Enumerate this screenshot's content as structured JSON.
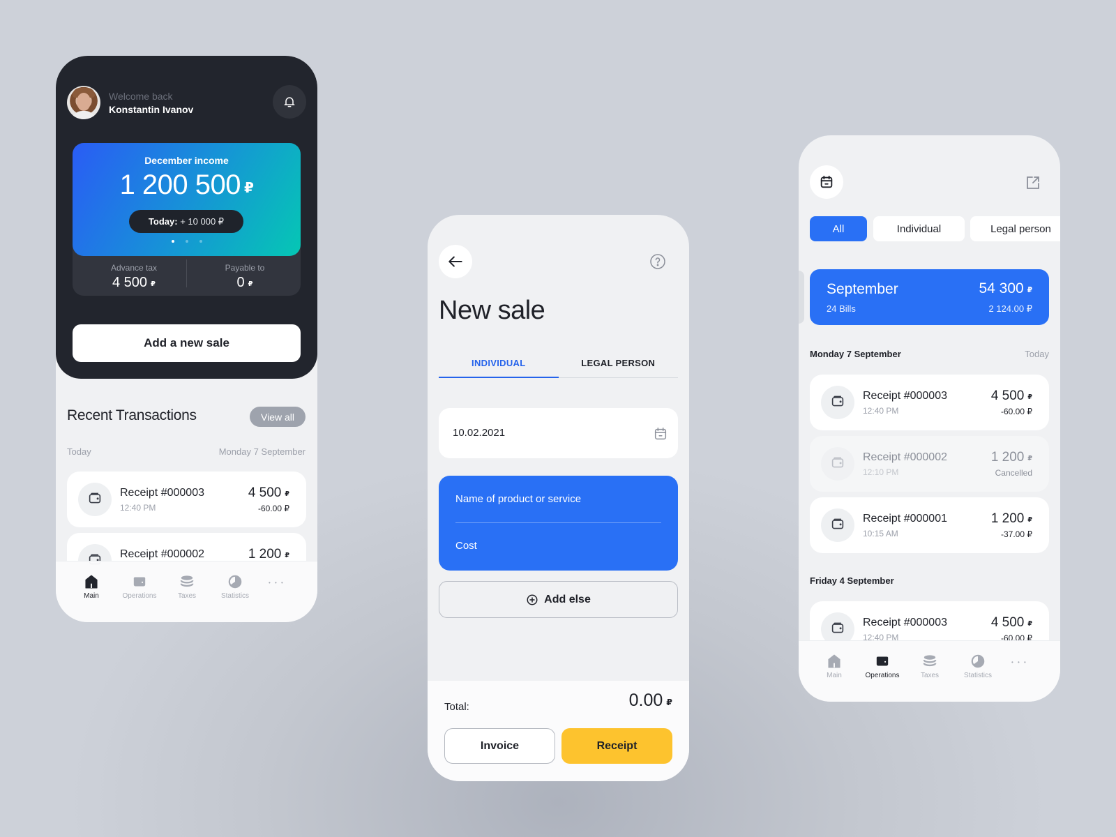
{
  "colors": {
    "accent_blue": "#2970f5",
    "dark_bg": "#22252d",
    "yellow": "#fdc32e",
    "page_bg": "#cdd1d9"
  },
  "home": {
    "welcome_label": "Welcome back",
    "user_name": "Konstantin Ivanov",
    "bell_icon": "bell-icon",
    "income_card": {
      "label": "December income",
      "amount": "1 200 500",
      "currency": "₽",
      "today_label": "Today:",
      "today_value": "+ 10 000 ₽",
      "pages": 3,
      "active_page": 1
    },
    "advance_tax": {
      "label": "Advance tax",
      "value": "4 500",
      "currency": "₽"
    },
    "payable_to": {
      "label": "Payable to",
      "value": "0",
      "currency": "₽"
    },
    "add_sale_label": "Add a new sale",
    "recent_title": "Recent Transactions",
    "view_all_label": "View all",
    "day_left": "Today",
    "day_right": "Monday 7 September",
    "transactions": [
      {
        "name": "Receipt #000003",
        "time": "12:40 PM",
        "amount": "4 500",
        "currency": "₽",
        "sub": "-60.00 ₽"
      },
      {
        "name": "Receipt #000002",
        "time": "",
        "amount": "1 200",
        "currency": "₽",
        "sub": ""
      }
    ],
    "tabbar": [
      {
        "label": "Main",
        "icon": "home-icon",
        "active": true
      },
      {
        "label": "Operations",
        "icon": "wallet-icon",
        "active": false
      },
      {
        "label": "Taxes",
        "icon": "coins-icon",
        "active": false
      },
      {
        "label": "Statistics",
        "icon": "pie-chart-icon",
        "active": false
      },
      {
        "label": "",
        "icon": "more-icon",
        "active": false
      }
    ]
  },
  "new_sale": {
    "title": "New sale",
    "tabs": [
      {
        "label": "INDIVIDUAL",
        "active": true
      },
      {
        "label": "LEGAL PERSON",
        "active": false
      }
    ],
    "date_value": "10.02.2021",
    "product_placeholder": "Name of product or service",
    "cost_placeholder": "Cost",
    "add_else_label": "Add else",
    "total_label": "Total:",
    "total_value": "0.00",
    "total_currency": "₽",
    "invoice_label": "Invoice",
    "receipt_label": "Receipt"
  },
  "operations": {
    "filters": [
      {
        "label": "All",
        "active": true
      },
      {
        "label": "Individual",
        "active": false
      },
      {
        "label": "Legal person",
        "active": false
      }
    ],
    "month_card": {
      "month": "September",
      "bills": "24 Bills",
      "amount": "54 300",
      "currency": "₽",
      "sub": "2 124.00 ₽"
    },
    "groups": [
      {
        "title": "Monday 7 September",
        "right": "Today",
        "items": [
          {
            "name": "Receipt #000003",
            "time": "12:40 PM",
            "amount": "4 500",
            "currency": "₽",
            "sub": "-60.00 ₽",
            "cancelled": false
          },
          {
            "name": "Receipt #000002",
            "time": "12:10 PM",
            "amount": "1 200",
            "currency": "₽",
            "sub": "Cancelled",
            "cancelled": true
          },
          {
            "name": "Receipt #000001",
            "time": "10:15 AM",
            "amount": "1 200",
            "currency": "₽",
            "sub": "-37.00 ₽",
            "cancelled": false
          }
        ]
      },
      {
        "title": "Friday 4 September",
        "right": "",
        "items": [
          {
            "name": "Receipt #000003",
            "time": "12:40 PM",
            "amount": "4 500",
            "currency": "₽",
            "sub": "-60.00 ₽",
            "cancelled": false
          }
        ]
      }
    ],
    "tabbar": [
      {
        "label": "Main",
        "icon": "home-icon",
        "active": false
      },
      {
        "label": "Operations",
        "icon": "wallet-icon",
        "active": true
      },
      {
        "label": "Taxes",
        "icon": "coins-icon",
        "active": false
      },
      {
        "label": "Statistics",
        "icon": "pie-chart-icon",
        "active": false
      },
      {
        "label": "",
        "icon": "more-icon",
        "active": false
      }
    ]
  }
}
